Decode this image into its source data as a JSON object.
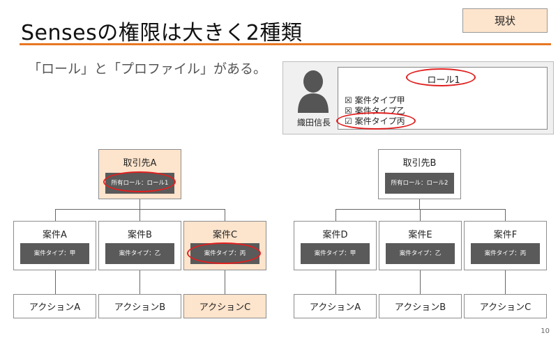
{
  "header": {
    "title": "Sensesの権限は大きく2種類",
    "status_badge": "現状"
  },
  "subtitle": "「ロール」と「プロファイル」がある。",
  "profile_panel": {
    "user_name": "織田信長",
    "role_name": "ロール1",
    "case_types": [
      {
        "label": "☒ 案件タイプ甲"
      },
      {
        "label": "☒ 案件タイプ乙"
      },
      {
        "label": "☑ 案件タイプ丙"
      }
    ]
  },
  "trees": [
    {
      "client": {
        "name": "取引先A",
        "role": "所有ロール：ロール1",
        "highlighted": true
      },
      "cases": [
        {
          "name": "案件A",
          "type": "案件タイプ：甲",
          "action": "アクションA",
          "highlighted": false
        },
        {
          "name": "案件B",
          "type": "案件タイプ：乙",
          "action": "アクションB",
          "highlighted": false
        },
        {
          "name": "案件C",
          "type": "案件タイプ：丙",
          "action": "アクションC",
          "highlighted": true
        }
      ]
    },
    {
      "client": {
        "name": "取引先B",
        "role": "所有ロール：ロール2",
        "highlighted": false
      },
      "cases": [
        {
          "name": "案件D",
          "type": "案件タイプ：甲",
          "action": "アクションA",
          "highlighted": false
        },
        {
          "name": "案件E",
          "type": "案件タイプ：乙",
          "action": "アクションB",
          "highlighted": false
        },
        {
          "name": "案件F",
          "type": "案件タイプ：丙",
          "action": "アクションC",
          "highlighted": false
        }
      ]
    }
  ],
  "page_number": "10",
  "colors": {
    "accent": "#e87722",
    "highlight": "#fde4cc",
    "circle": "#e02020"
  }
}
